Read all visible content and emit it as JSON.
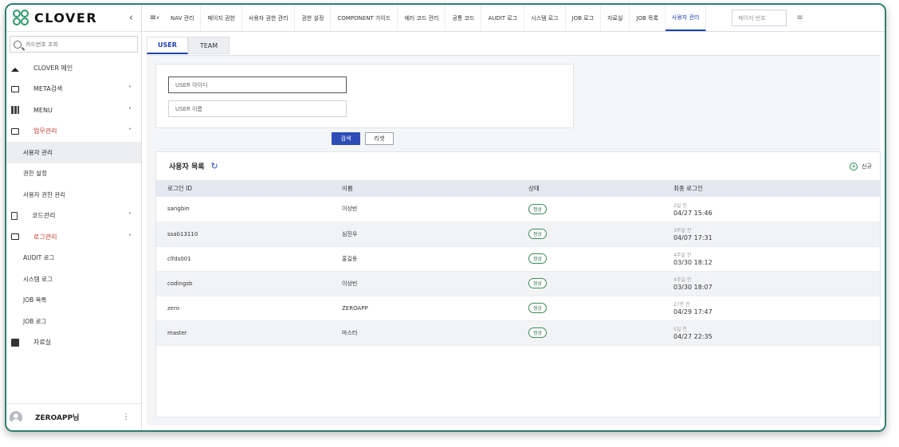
{
  "brand": {
    "name": "CLOVER",
    "color": "#2f9a6e"
  },
  "sidebar": {
    "search_placeholder": "카드번호 조회",
    "items": [
      {
        "label": "CLOVER 메인",
        "icon": "home-icon",
        "type": "main"
      },
      {
        "label": "META검색",
        "icon": "folder-icon",
        "type": "main",
        "chevron": "v"
      },
      {
        "label": "MENU",
        "icon": "grid-icon",
        "type": "main",
        "chevron": "v"
      },
      {
        "label": "업무관리",
        "icon": "folder-icon",
        "type": "main",
        "chevron": "^",
        "expanded": true
      },
      {
        "label": "사용자 관리",
        "type": "sub",
        "active": true
      },
      {
        "label": "권한 설정",
        "type": "sub"
      },
      {
        "label": "사용자 권한 관리",
        "type": "sub"
      },
      {
        "label": "코드관리",
        "icon": "document-icon",
        "type": "main",
        "chevron": "v"
      },
      {
        "label": "로그관리",
        "icon": "folder-icon",
        "type": "main",
        "chevron": "^",
        "expanded": true
      },
      {
        "label": "AUDIT 로그",
        "type": "sub"
      },
      {
        "label": "시스템 로그",
        "type": "sub"
      },
      {
        "label": "JOB 목록",
        "type": "sub"
      },
      {
        "label": "JOB 로그",
        "type": "sub"
      },
      {
        "label": "자료실",
        "icon": "edit-icon",
        "type": "main"
      }
    ],
    "user_name": "ZEROAPP님"
  },
  "topbar": {
    "tabs": [
      "NAV 관리",
      "페이지 권한",
      "사용자 권한 관리",
      "권한 설정",
      "COMPONENT 가이드",
      "에러 코드 관리",
      "공통 코드",
      "AUDIT 로그",
      "시스템 로그",
      "JOB 로그",
      "자료실",
      "JOB 목록",
      "사용자 관리"
    ],
    "active_tab": "사용자 관리",
    "page_placeholder": "페이지 번호"
  },
  "main": {
    "subtabs": [
      "USER",
      "TEAM"
    ],
    "active_subtab": "USER",
    "filters": {
      "id_placeholder": "USER 아이디",
      "name_placeholder": "USER 이름",
      "search_label": "검색",
      "reset_label": "리셋"
    },
    "list": {
      "title": "사용자 목록",
      "new_label": "신규",
      "columns": [
        "로그인 ID",
        "이름",
        "상태",
        "최종 로그인"
      ],
      "rows": [
        {
          "login_id": "sangbin",
          "name": "이상빈",
          "status": "정상",
          "ago": "2일 전",
          "last_login": "04/27 15:46"
        },
        {
          "login_id": "ssab13110",
          "name": "심진우",
          "status": "정상",
          "ago": "3주일 전",
          "last_login": "04/07 17:31"
        },
        {
          "login_id": "clfds001",
          "name": "홍길동",
          "status": "정상",
          "ago": "4주일 전",
          "last_login": "03/30 18:12"
        },
        {
          "login_id": "codingsb",
          "name": "이상빈",
          "status": "정상",
          "ago": "4주일 전",
          "last_login": "03/30 18:07"
        },
        {
          "login_id": "zero",
          "name": "ZEROAPP",
          "status": "정상",
          "ago": "27분 전",
          "last_login": "04/29 17:47"
        },
        {
          "login_id": "master",
          "name": "마스터",
          "status": "정상",
          "ago": "1일 전",
          "last_login": "04/27 22:35"
        }
      ]
    }
  }
}
